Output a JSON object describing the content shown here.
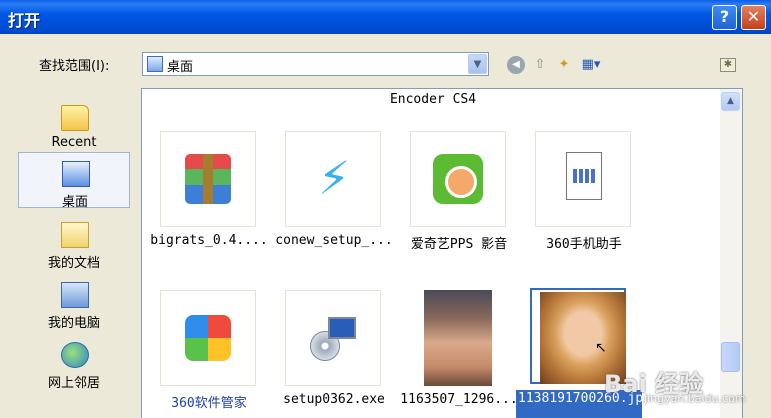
{
  "window": {
    "title": "打开",
    "help_label": "?",
    "close_label": "✕"
  },
  "toolbar": {
    "look_in_label": "查找范围(I):",
    "look_in_value": "桌面",
    "dropdown_icon": "chevron-down-icon",
    "back_icon": "back-arrow-icon",
    "up_icon": "up-folder-icon",
    "new_folder_icon": "new-folder-icon",
    "view_icon": "view-menu-icon",
    "desktop_icon": "desktop-icon"
  },
  "places": [
    {
      "label": "Recent",
      "icon": "recent-folder-icon"
    },
    {
      "label": "桌面",
      "icon": "desktop-icon"
    },
    {
      "label": "我的文档",
      "icon": "my-documents-icon"
    },
    {
      "label": "我的电脑",
      "icon": "my-computer-icon"
    },
    {
      "label": "网上邻居",
      "icon": "network-icon"
    }
  ],
  "file_list": {
    "group_header": "Encoder CS4",
    "items": [
      {
        "label": "bigrats_0.4....",
        "icon": "winrar-archive-icon"
      },
      {
        "label": "conew_setup_...",
        "icon": "paw-app-icon"
      },
      {
        "label": "爱奇艺PPS 影音",
        "icon": "iqiyi-app-icon"
      },
      {
        "label": "360手机助手",
        "icon": "generic-file-icon"
      },
      {
        "label": "360软件管家",
        "icon": "360-app-icon"
      },
      {
        "label": "setup0362.exe",
        "icon": "setup-installer-icon"
      },
      {
        "label": "1163507_1296...",
        "icon": "photo-thumbnail"
      },
      {
        "label": "1138191700260.jpg",
        "icon": "photo-thumbnail"
      }
    ]
  },
  "watermark": {
    "text": "Bai 经验",
    "subtext": "jingyan.baidu.com"
  },
  "colors": {
    "titlebar": "#0058E6",
    "selection": "#316AC5",
    "dialog_bg": "#ECE9D8"
  }
}
